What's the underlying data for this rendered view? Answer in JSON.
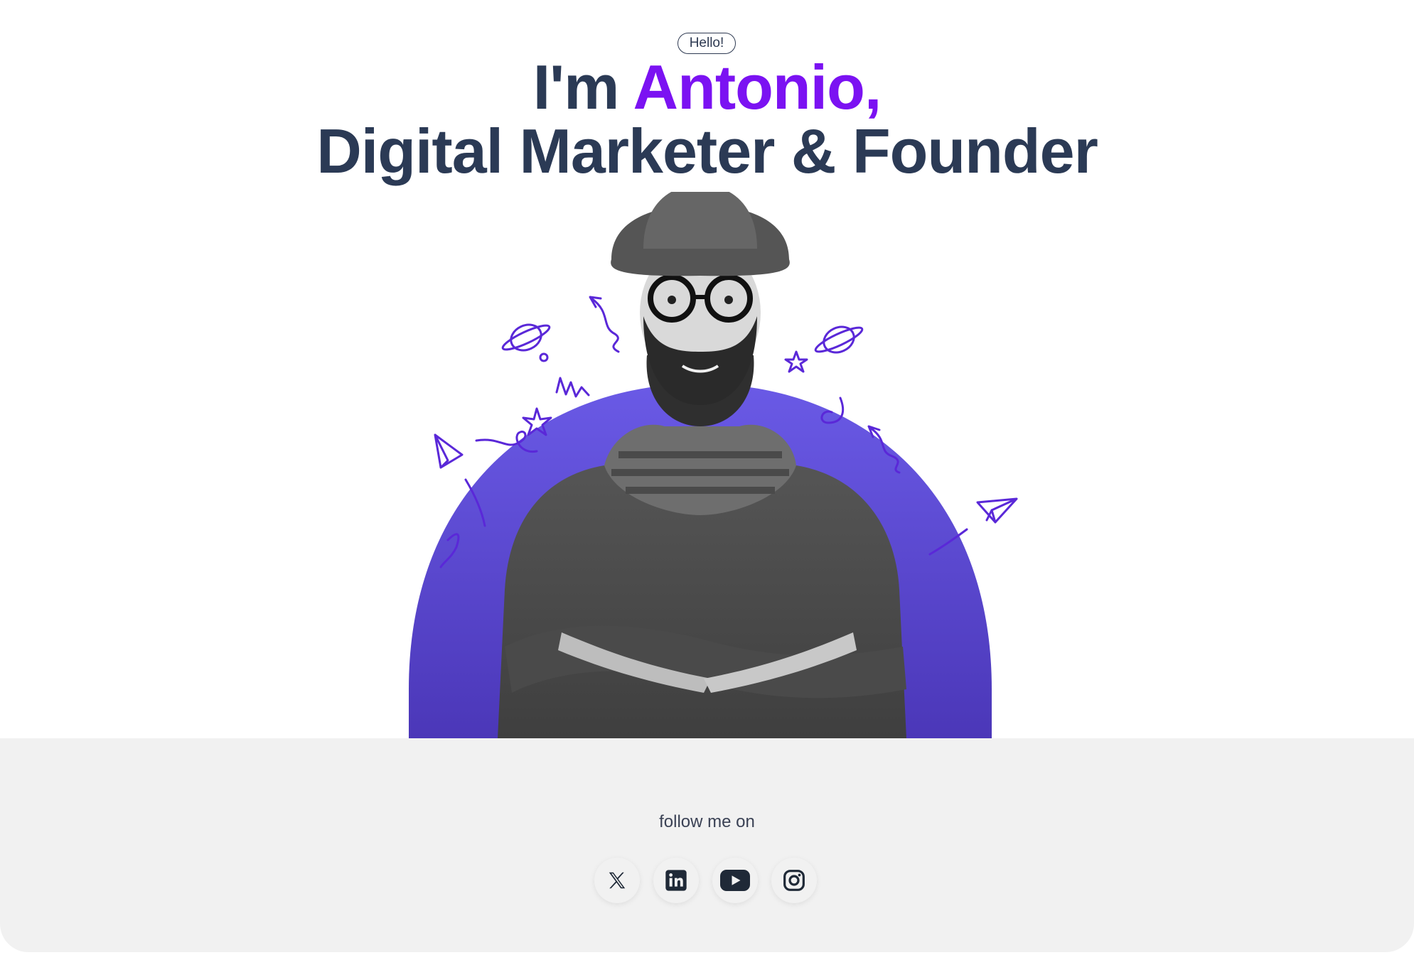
{
  "hero": {
    "greeting": "Hello!",
    "headline_prefix": "I'm ",
    "headline_name": "Antonio,",
    "headline_line2": "Digital Marketer & Founder",
    "accent_color": "#7b12f2",
    "text_color": "#2b3a55",
    "arch_color_top": "#6a5ae6",
    "arch_color_bottom": "#4b37b8"
  },
  "portrait": {
    "icon": "person-portrait-illustration"
  },
  "follow": {
    "label": "follow me on",
    "background": "#f1f1f1",
    "socials": [
      {
        "name": "x",
        "icon": "x-icon"
      },
      {
        "name": "linkedin",
        "icon": "linkedin-icon"
      },
      {
        "name": "youtube",
        "icon": "youtube-icon"
      },
      {
        "name": "instagram",
        "icon": "instagram-icon"
      }
    ]
  }
}
